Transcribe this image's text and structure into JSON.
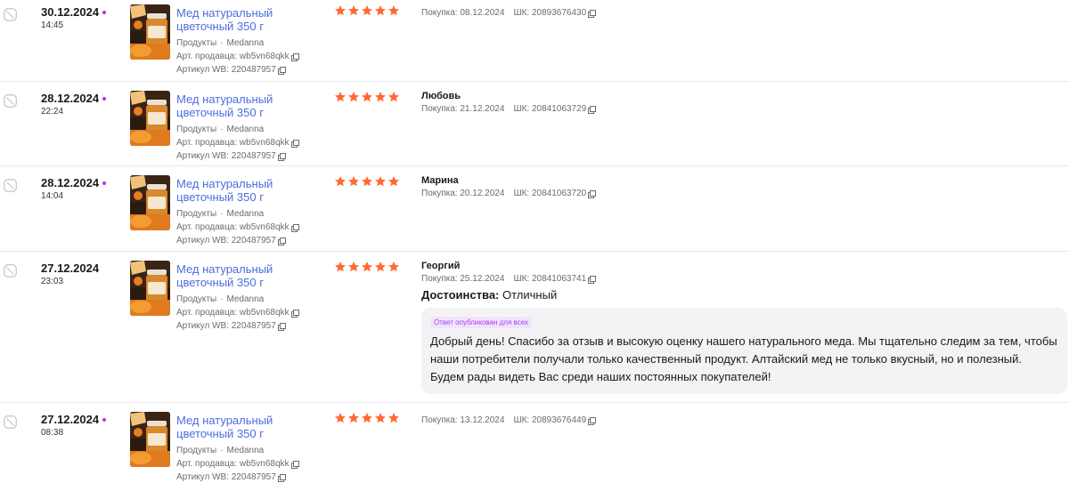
{
  "product": {
    "name": "Мед натуральный цветочный 350 г",
    "category": "Продукты",
    "brand": "Medanna",
    "seller_art_label": "Арт. продавца:",
    "seller_art": "wb5vn68qkk",
    "wb_art_label": "Артикул WB:",
    "wb_art": "220487957"
  },
  "labels": {
    "purchase": "Покупка:",
    "barcode": "ШК:",
    "pros": "Достоинства:",
    "published_badge": "Ответ опубликован для всех"
  },
  "colors": {
    "accent": "#a33ef0",
    "link": "#4c6de0",
    "star": "#ff6a33"
  },
  "reviews": [
    {
      "date": "30.12.2024",
      "time": "14:45",
      "unread": true,
      "rating": 5,
      "author": "",
      "purchase_date": "08.12.2024",
      "barcode": "20893676430"
    },
    {
      "date": "28.12.2024",
      "time": "22:24",
      "unread": true,
      "rating": 5,
      "author": "Любовь",
      "purchase_date": "21.12.2024",
      "barcode": "20841063729"
    },
    {
      "date": "28.12.2024",
      "time": "14:04",
      "unread": true,
      "rating": 5,
      "author": "Марина",
      "purchase_date": "20.12.2024",
      "barcode": "20841063720"
    },
    {
      "date": "27.12.2024",
      "time": "23:03",
      "unread": false,
      "rating": 5,
      "author": "Георгий",
      "purchase_date": "25.12.2024",
      "barcode": "20841063741",
      "pros_value": "Отличный",
      "answer": "Добрый день! Спасибо за отзыв и высокую оценку нашего натурального меда. Мы тщательно следим за тем, чтобы наши потребители получали только качественный продукт. Алтайский мед не только вкусный, но и полезный. Будем рады видеть Вас среди наших постоянных покупателей!"
    },
    {
      "date": "27.12.2024",
      "time": "08:38",
      "unread": true,
      "rating": 5,
      "author": "",
      "purchase_date": "13.12.2024",
      "barcode": "20893676449"
    }
  ]
}
